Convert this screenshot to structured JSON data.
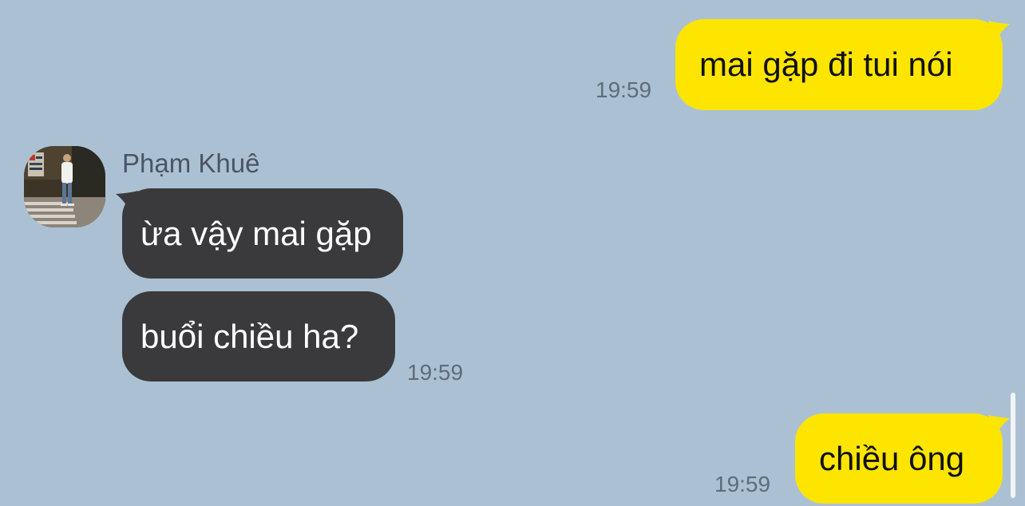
{
  "messages": [
    {
      "direction": "outgoing",
      "text": "mai gặp đi tui nói",
      "time": "19:59"
    },
    {
      "direction": "incoming",
      "sender": "Phạm Khuê",
      "text": "ừa vậy mai gặp"
    },
    {
      "direction": "incoming",
      "text": "buổi chiều ha?",
      "time": "19:59"
    },
    {
      "direction": "outgoing",
      "text": "chiều ông",
      "time": "19:59"
    }
  ],
  "colors": {
    "background": "#abc1d3",
    "outgoing_bubble": "#fee500",
    "incoming_bubble": "#3a3a3c",
    "timestamp": "#5f6c78"
  },
  "icons": {
    "avatar": "profile-photo-avatar"
  }
}
